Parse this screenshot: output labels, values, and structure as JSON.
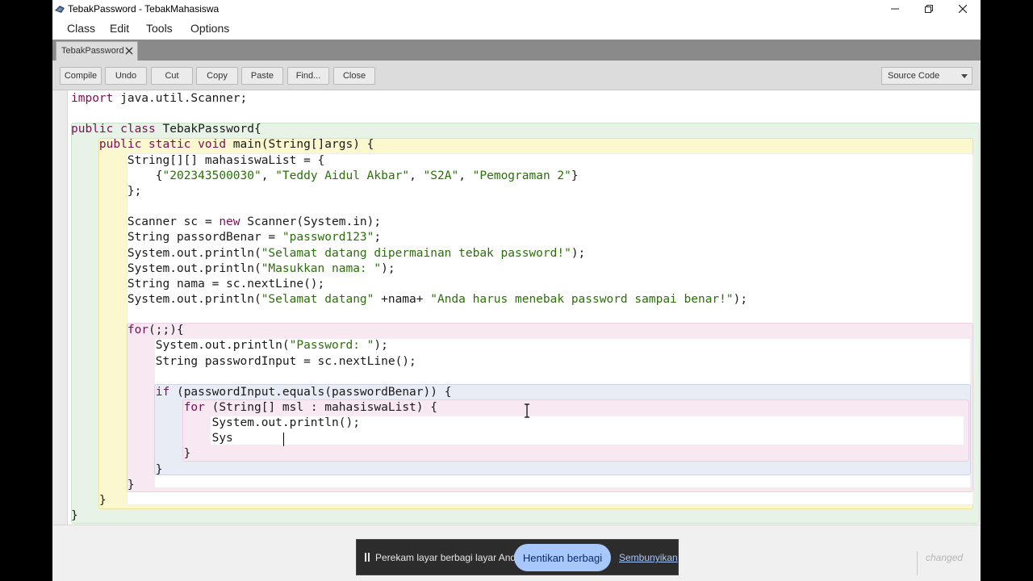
{
  "window": {
    "title": "TebakPassword - TebakMahasiswa"
  },
  "menu": {
    "items": [
      "Class",
      "Edit",
      "Tools",
      "Options"
    ]
  },
  "tab": {
    "label": "TebakPassword"
  },
  "toolbar": {
    "buttons": [
      "Compile",
      "Undo",
      "Cut",
      "Copy",
      "Paste",
      "Find...",
      "Close"
    ],
    "view_select": "Source Code"
  },
  "code": {
    "lines": [
      [
        {
          "t": "import",
          "c": "kw"
        },
        {
          "t": " java.util.Scanner;"
        }
      ],
      [],
      [
        {
          "t": "public class",
          "c": "kw"
        },
        {
          "t": " TebakPassword{"
        }
      ],
      [
        {
          "t": "    "
        },
        {
          "t": "public static void",
          "c": "kw"
        },
        {
          "t": " main(String[]args) {"
        }
      ],
      [
        {
          "t": "        String[][] mahasiswaList = {"
        }
      ],
      [
        {
          "t": "            {"
        },
        {
          "t": "\"202343500030\"",
          "c": "str"
        },
        {
          "t": ", "
        },
        {
          "t": "\"Teddy Aidul Akbar\"",
          "c": "str"
        },
        {
          "t": ", "
        },
        {
          "t": "\"S2A\"",
          "c": "str"
        },
        {
          "t": ", "
        },
        {
          "t": "\"Pemograman 2\"",
          "c": "str"
        },
        {
          "t": "}"
        }
      ],
      [
        {
          "t": "        };"
        }
      ],
      [],
      [
        {
          "t": "        Scanner sc = "
        },
        {
          "t": "new",
          "c": "kw"
        },
        {
          "t": " Scanner(System.in);"
        }
      ],
      [
        {
          "t": "        String passordBenar = "
        },
        {
          "t": "\"password123\"",
          "c": "str"
        },
        {
          "t": ";"
        }
      ],
      [
        {
          "t": "        System.out.println("
        },
        {
          "t": "\"Selamat datang dipermainan tebak password!\"",
          "c": "str"
        },
        {
          "t": ");"
        }
      ],
      [
        {
          "t": "        System.out.println("
        },
        {
          "t": "\"Masukkan nama: \"",
          "c": "str"
        },
        {
          "t": ");"
        }
      ],
      [
        {
          "t": "        String nama = sc.nextLine();"
        }
      ],
      [
        {
          "t": "        System.out.println("
        },
        {
          "t": "\"Selamat datang\"",
          "c": "str"
        },
        {
          "t": " +nama+ "
        },
        {
          "t": "\"Anda harus menebak password sampai benar!\"",
          "c": "str"
        },
        {
          "t": ");"
        }
      ],
      [],
      [
        {
          "t": "        "
        },
        {
          "t": "for",
          "c": "kw"
        },
        {
          "t": "(;;){"
        }
      ],
      [
        {
          "t": "            System.out.println("
        },
        {
          "t": "\"Password: \"",
          "c": "str"
        },
        {
          "t": ");"
        }
      ],
      [
        {
          "t": "            String passwordInput = sc.nextLine();"
        }
      ],
      [],
      [
        {
          "t": "            "
        },
        {
          "t": "if",
          "c": "kw"
        },
        {
          "t": " (passwordInput.equals(passwordBenar)) {"
        }
      ],
      [
        {
          "t": "                "
        },
        {
          "t": "for",
          "c": "kw"
        },
        {
          "t": " (String[] msl : mahasiswaList) {"
        }
      ],
      [
        {
          "t": "                    System.out.println();"
        }
      ],
      [
        {
          "t": "                    Sys"
        }
      ],
      [
        {
          "t": "                }"
        }
      ],
      [
        {
          "t": "            }"
        }
      ],
      [
        {
          "t": "        }"
        }
      ],
      [
        {
          "t": "    }"
        }
      ],
      [
        {
          "t": "}"
        }
      ]
    ]
  },
  "status": {
    "changed": "changed"
  },
  "share_notification": {
    "text": "Perekam layar berbagi layar Anda.",
    "stop_button": "Hentikan berbagi",
    "hide_link": "Sembunyikan"
  },
  "colors": {
    "keyword": "#7a0f57",
    "string": "#2b6f0a",
    "share_button": "#a8c7fa"
  }
}
